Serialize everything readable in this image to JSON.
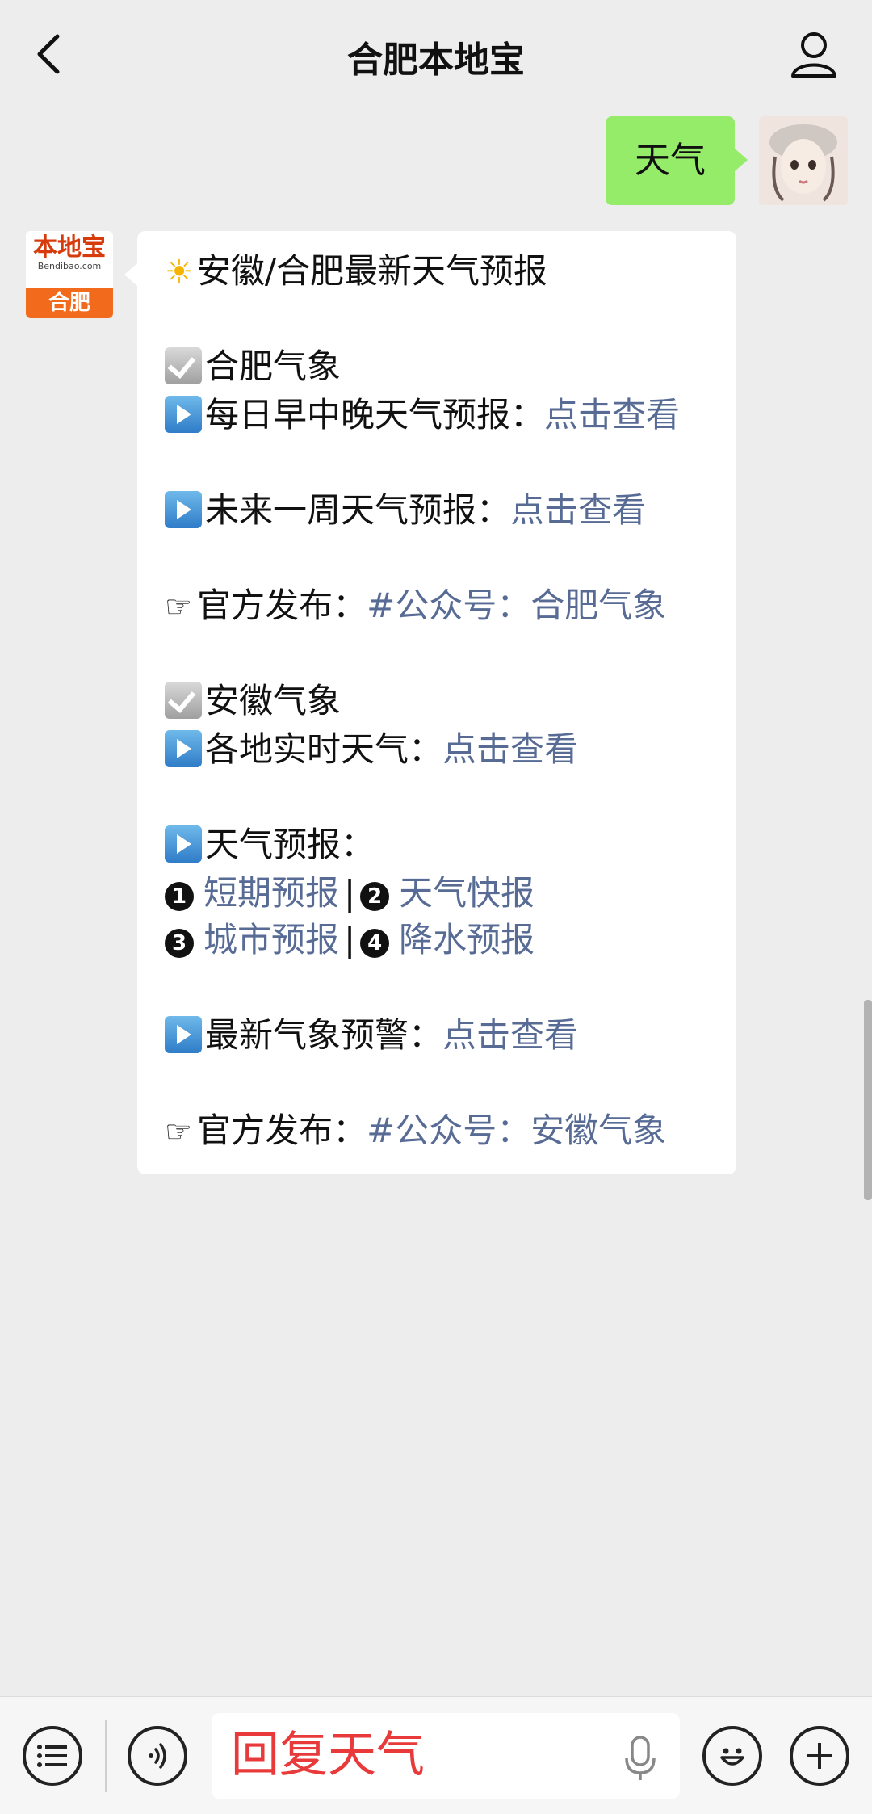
{
  "header": {
    "title": "合肥本地宝"
  },
  "chat": {
    "user_message": "天气",
    "bot": {
      "logo_text": "本地宝",
      "logo_site": "Bendibao.com",
      "logo_city": "合肥"
    },
    "reply": {
      "title": "安徽/合肥最新天气预报",
      "section1_title": "合肥气象",
      "item1_label": "每日早中晚天气预报：",
      "item1_link": "点击查看",
      "item2_label": "未来一周天气预报：",
      "item2_link": "点击查看",
      "official1_label": "官方发布：",
      "official1_link": "#公众号：合肥气象",
      "section2_title": "安徽气象",
      "item3_label": "各地实时天气：",
      "item3_link": "点击查看",
      "forecast_label": "天气预报：",
      "forecast_links": [
        "短期预报",
        "天气快报",
        "城市预报",
        "降水预报"
      ],
      "forecast_nums": [
        "1",
        "2",
        "3",
        "4"
      ],
      "item4_label": "最新气象预警：",
      "item4_link": "点击查看",
      "official2_label": "官方发布：",
      "official2_link": "#公众号：安徽气象"
    }
  },
  "bottom": {
    "input_value": "回复天气"
  }
}
